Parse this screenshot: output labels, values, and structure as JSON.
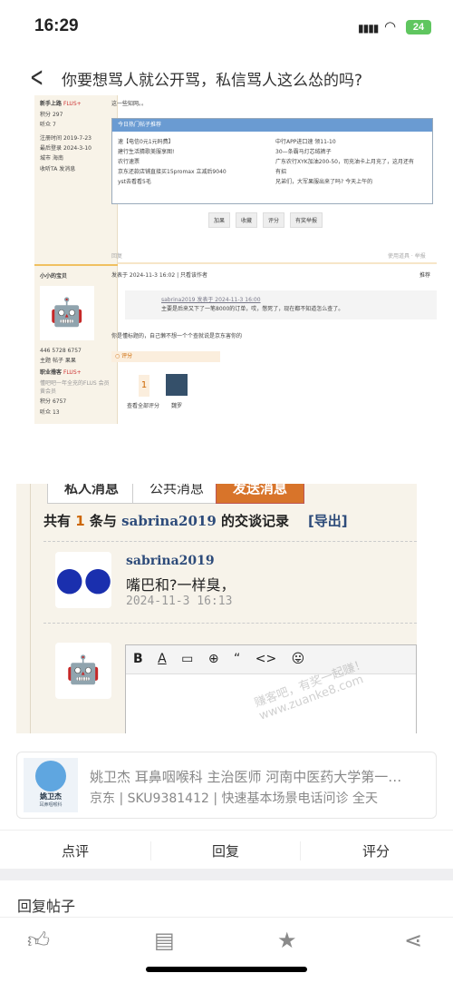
{
  "status": {
    "time": "16:29",
    "battery": "24"
  },
  "nav": {
    "title": "你要想骂人就公开骂，私信骂人这么怂的吗?"
  },
  "shot1": {
    "top_text": "这一些知网。。",
    "user1": {
      "rank": "新手上路",
      "badge": "FLUS+",
      "rows": [
        [
          "积分",
          "297"
        ],
        [
          "听众",
          "7"
        ],
        [
          "注册时间",
          "2019-7-23"
        ],
        [
          "最后登录",
          "2024-3-10"
        ],
        [
          "城市",
          "海南"
        ]
      ],
      "actions": [
        "收听TA",
        "发消息"
      ]
    },
    "hot": {
      "title": "今日热门帖子推荐",
      "left": [
        "速【电信0元1元码费】",
        "建行生活猜歌美服享图!",
        "农行速票",
        "京东还款店铺直接买15promax 立减后9040",
        "yst去看看5毛"
      ],
      "right": [
        "中行APP进口速 领11-10",
        "30—条霸马灯芯绒裤子",
        "广东农行XYK加油200-50，司充油卡上月充了，这月还有",
        "有招",
        "兄弟们，大军果服出来了吗? 今天上午的"
      ]
    },
    "buttons": [
      "加果",
      "收藏",
      "评分",
      "有奖举报"
    ],
    "reply_label": "回复",
    "report": "使用道具 · 举报",
    "user2": {
      "name": "小小的宝贝",
      "stats": [
        [
          "446",
          "主题"
        ],
        [
          "5728",
          "帖子"
        ],
        [
          "6757",
          "果果"
        ]
      ],
      "rank": "职业撸客",
      "badge": "FLUS+",
      "desc": "懂吧吧一年全充的FLUS 会员黄会员",
      "rows": [
        [
          "积分",
          "6757"
        ],
        [
          "听众",
          "13"
        ]
      ]
    },
    "post": {
      "meta": "发表于 2024-11-3 16:02",
      "author_only": "只看该作者",
      "floor": "推荐",
      "quote_head": "sabrina2019 发表于 2024-11-3 16:00",
      "quote": "主要是后来又下了一笔8000的订单，哎，憋死了，现在都不知道怎么查了。",
      "body": "你是懂标题的，自己懒不想一个个查就说是京东害你的",
      "rate_label": "评分",
      "rate_count": "1",
      "rate_all": "查看全部评分",
      "rater": "魏罗"
    }
  },
  "shot2": {
    "tabs": [
      "私人消息",
      "公共消息",
      "发送消息"
    ],
    "summary_pre": "共有",
    "count": "1",
    "summary_mid": "条与",
    "user": "sabrina2019",
    "summary_post": "的交谈记录",
    "export": "[导出]",
    "msg": {
      "name": "sabrina2019",
      "text": "嘴巴和?一样臭，",
      "time": "2024-11-3 16:13"
    },
    "watermark": "赚客吧，有奖一起赚！ www.zuanke8.com"
  },
  "ad": {
    "avatar_name": "姚卫杰",
    "avatar_dept": "耳鼻咽喉科",
    "title": "姚卫杰 耳鼻咽喉科 主治医师 河南中医药大学第一…",
    "sub": "京东 | SKU9381412 | 快速基本场景电话问诊 全天"
  },
  "actions": [
    "点评",
    "回复",
    "评分"
  ],
  "reply_post": "回复帖子",
  "bottom": [
    "thumbs-up",
    "comment",
    "star",
    "share"
  ]
}
